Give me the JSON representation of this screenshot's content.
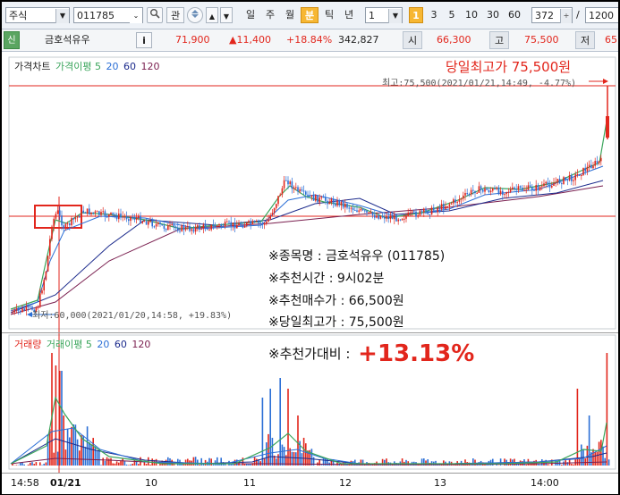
{
  "toolbar": {
    "market": "주식",
    "code": "011785",
    "gwan": "관",
    "periods": [
      "일",
      "주",
      "월",
      "분",
      "틱",
      "년"
    ],
    "active_period": "분",
    "interval_value": "1",
    "quick_intervals": [
      "1",
      "3",
      "5",
      "10",
      "30",
      "60"
    ],
    "active_interval": "1",
    "count_value": "372",
    "slash": "/",
    "total_value": "1200"
  },
  "quote": {
    "tag": "신",
    "name": "금호석유우",
    "info_icon": "i",
    "price": "71,900",
    "change": "▲11,400",
    "change_pct": "+18.84%",
    "volume": "342,827",
    "open_label": "시",
    "open": "66,300",
    "high_label": "고",
    "high": "75,500",
    "low_label": "저",
    "low": "65"
  },
  "price_pane": {
    "legend": [
      {
        "text": "가격차트",
        "color": "#222222"
      },
      {
        "text": "가격이평 5",
        "color": "#3aa55b"
      },
      {
        "text": "20",
        "color": "#2b6fd6"
      },
      {
        "text": "60",
        "color": "#1b2a8c"
      },
      {
        "text": "120",
        "color": "#7a1f4f"
      }
    ],
    "headline": "당일최고가 75,500원",
    "high_note": "최고:75,500(2021/01/21,14:49, -4.77%)",
    "low_note": "최저:60,000(2021/01/20,14:58, +19.83%)"
  },
  "overlay": {
    "item": "※종목명 : 금호석유우 (011785)",
    "time": "※추천시간 : 9시02분",
    "buy_price": "※추천매수가 : 66,500원",
    "day_high": "※당일최고가 : 75,500원",
    "vs_label": "※추천가대비 :",
    "vs_value": "+13.13%"
  },
  "volume_pane": {
    "legend": [
      {
        "text": "거래량",
        "color": "#e2261c"
      },
      {
        "text": "거래이평 5",
        "color": "#3aa55b"
      },
      {
        "text": "20",
        "color": "#2b6fd6"
      },
      {
        "text": "60",
        "color": "#1b2a8c"
      },
      {
        "text": "120",
        "color": "#7a1f4f"
      }
    ]
  },
  "x_axis": {
    "labels": [
      "14:58",
      "01/21",
      "10",
      "11",
      "12",
      "13",
      "14:00"
    ]
  },
  "colors": {
    "up": "#e2261c",
    "down": "#2b6fd6",
    "accent": "#f7b733"
  }
}
